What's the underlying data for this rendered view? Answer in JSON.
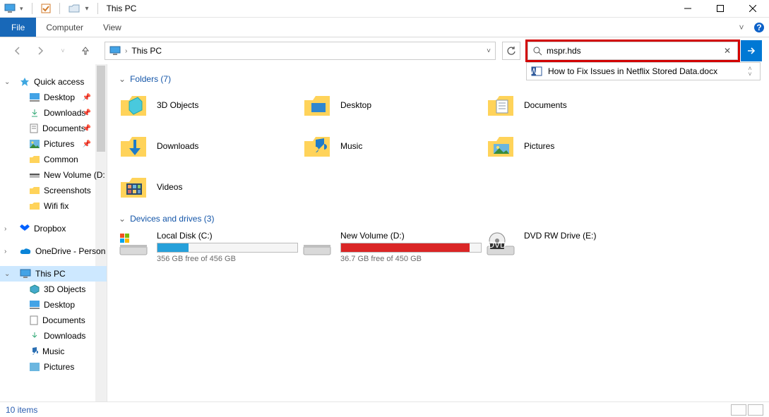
{
  "window": {
    "title": "This PC"
  },
  "ribbon": {
    "file": "File",
    "tabs": [
      "Computer",
      "View"
    ]
  },
  "address": {
    "location": "This PC"
  },
  "search": {
    "value": "mspr.hds",
    "suggestion": "How to Fix Issues in Netflix Stored Data.docx"
  },
  "sidebar": {
    "quick_access": {
      "label": "Quick access",
      "items": [
        {
          "label": "Desktop",
          "pinned": true
        },
        {
          "label": "Downloads",
          "pinned": true
        },
        {
          "label": "Documents",
          "pinned": true
        },
        {
          "label": "Pictures",
          "pinned": true
        },
        {
          "label": "Common",
          "pinned": false
        },
        {
          "label": "New Volume (D:",
          "pinned": false
        },
        {
          "label": "Screenshots",
          "pinned": false
        },
        {
          "label": "Wifi fix",
          "pinned": false
        }
      ]
    },
    "dropbox": {
      "label": "Dropbox"
    },
    "onedrive": {
      "label": "OneDrive - Person"
    },
    "this_pc": {
      "label": "This PC",
      "children": [
        "3D Objects",
        "Desktop",
        "Documents",
        "Downloads",
        "Music",
        "Pictures"
      ]
    }
  },
  "sections": {
    "folders": {
      "title": "Folders (7)",
      "items": [
        "3D Objects",
        "Desktop",
        "Documents",
        "Downloads",
        "Music",
        "Pictures",
        "Videos"
      ]
    },
    "drives": {
      "title": "Devices and drives (3)",
      "items": [
        {
          "name": "Local Disk (C:)",
          "sub": "356 GB free of 456 GB",
          "fill_pct": 22,
          "color": "#26a0da"
        },
        {
          "name": "New Volume (D:)",
          "sub": "36.7 GB free of 450 GB",
          "fill_pct": 92,
          "color": "#da2626"
        },
        {
          "name": "DVD RW Drive (E:)",
          "sub": "",
          "fill_pct": 0,
          "color": ""
        }
      ]
    }
  },
  "status": {
    "text": "10 items"
  }
}
